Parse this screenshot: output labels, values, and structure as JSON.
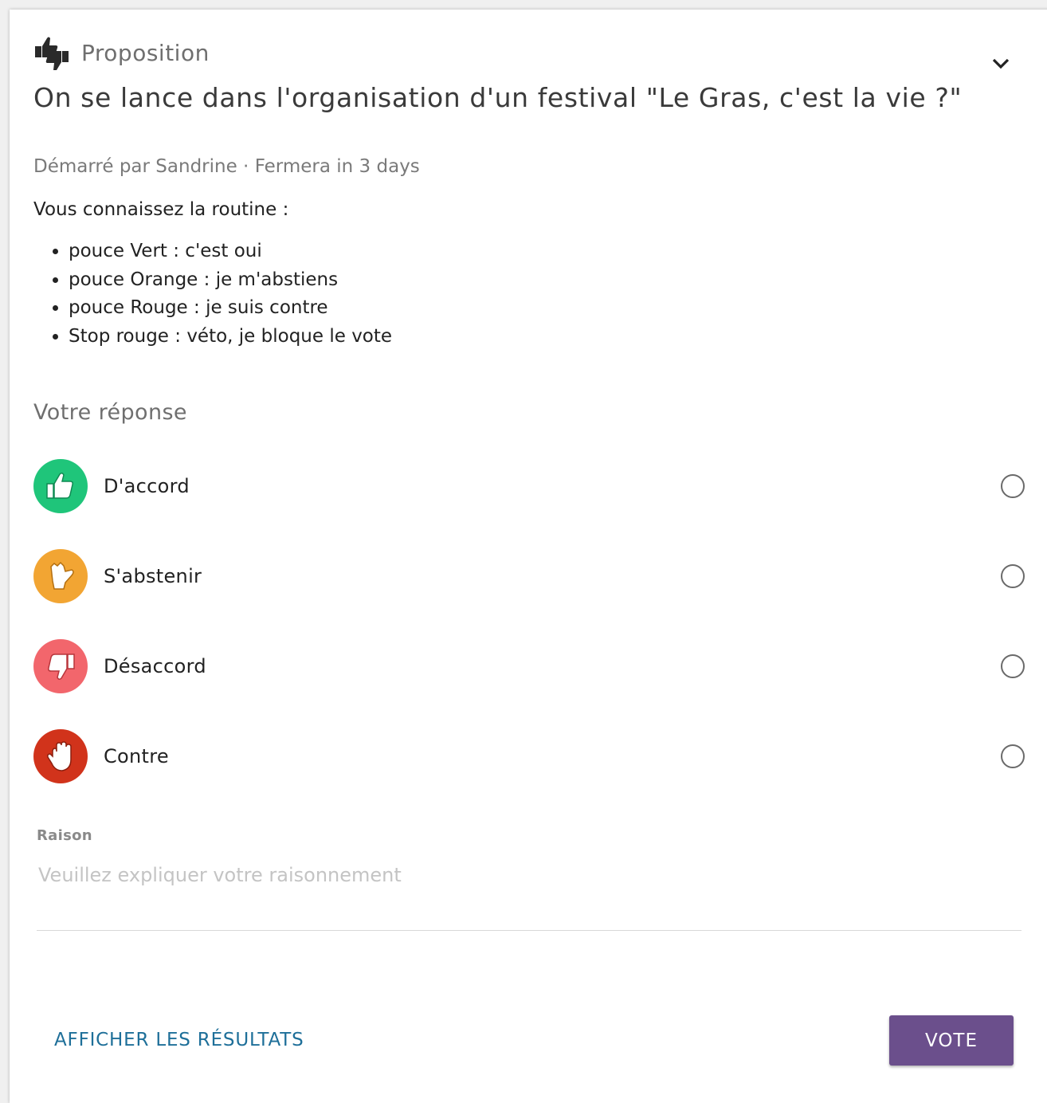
{
  "poll": {
    "type_label": "Proposition",
    "title": "On se lance dans l'organisation d'un festival \"Le Gras, c'est la vie ?\"",
    "meta_prefix": "Démarré par ",
    "author": "Sandrine",
    "meta_separator": " · ",
    "closing": "Fermera in 3 days",
    "description": "Vous connaissez la routine :",
    "rules": [
      "pouce Vert : c'est oui",
      "pouce Orange : je m'abstiens",
      "pouce Rouge : je suis contre",
      "Stop rouge : véto, je bloque le vote"
    ]
  },
  "response": {
    "section_label": "Votre réponse",
    "options": [
      {
        "label": "D'accord",
        "icon": "thumbs-up-icon",
        "color": "#1fc57a"
      },
      {
        "label": "S'abstenir",
        "icon": "hand-abstain-icon",
        "color": "#f2a533"
      },
      {
        "label": "Désaccord",
        "icon": "thumbs-down-icon",
        "color": "#f2666c"
      },
      {
        "label": "Contre",
        "icon": "stop-hand-icon",
        "color": "#d1331b"
      }
    ]
  },
  "reason": {
    "label": "Raison",
    "placeholder": "Veuillez expliquer votre raisonnement"
  },
  "actions": {
    "show_results": "AFFICHER LES RÉSULTATS",
    "vote": "VOTE"
  },
  "colors": {
    "vote_button": "#6b4f8c",
    "link": "#1e6f99"
  }
}
